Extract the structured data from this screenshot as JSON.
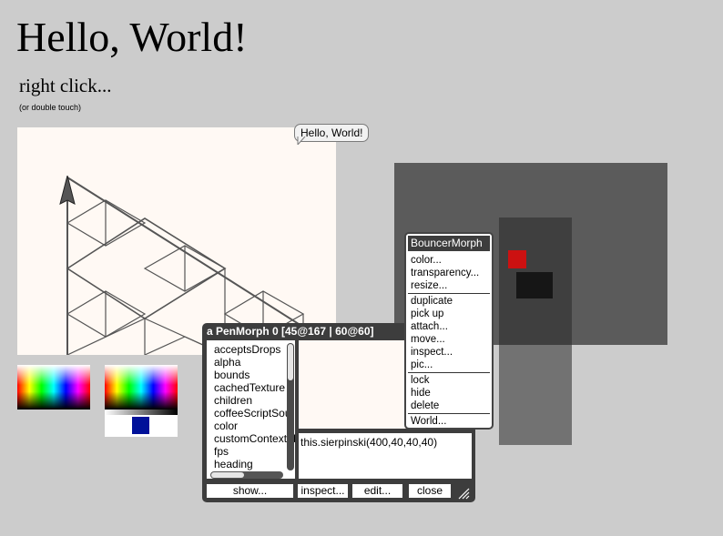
{
  "heading": "Hello, World!",
  "subheading": "right click...",
  "hint": "(or double touch)",
  "speech_bubble": "Hello, World!",
  "inspector": {
    "title": "a PenMorph 0 [45@167 | 60@60]",
    "properties": [
      "acceptsDrops",
      "alpha",
      "bounds",
      "cachedTexture",
      "children",
      "coffeeScriptSou",
      "color",
      "customContextM",
      "fps",
      "heading"
    ],
    "eval_text": "this.sierpinski(400,40,40,40)",
    "buttons": {
      "show": "show...",
      "inspect": "inspect...",
      "edit": "edit...",
      "close": "close"
    }
  },
  "context_menu": {
    "title": "BouncerMorph",
    "group1": [
      "color...",
      "transparency...",
      "resize..."
    ],
    "group2": [
      "duplicate",
      "pick up",
      "attach...",
      "move...",
      "inspect...",
      "pic..."
    ],
    "group3": [
      "lock",
      "hide",
      "delete"
    ],
    "group4": [
      "World..."
    ]
  },
  "colors": {
    "background": "#cccccc",
    "canvas": "#fff9f4",
    "bouncer_area": "#5b5b5b",
    "bouncer_column": "#3a3a3a",
    "red_box": "#cc1111",
    "black_box": "#161616",
    "swatch": "#001199"
  },
  "icons": [
    "turtle-arrow-icon",
    "resize-grip-icon"
  ]
}
